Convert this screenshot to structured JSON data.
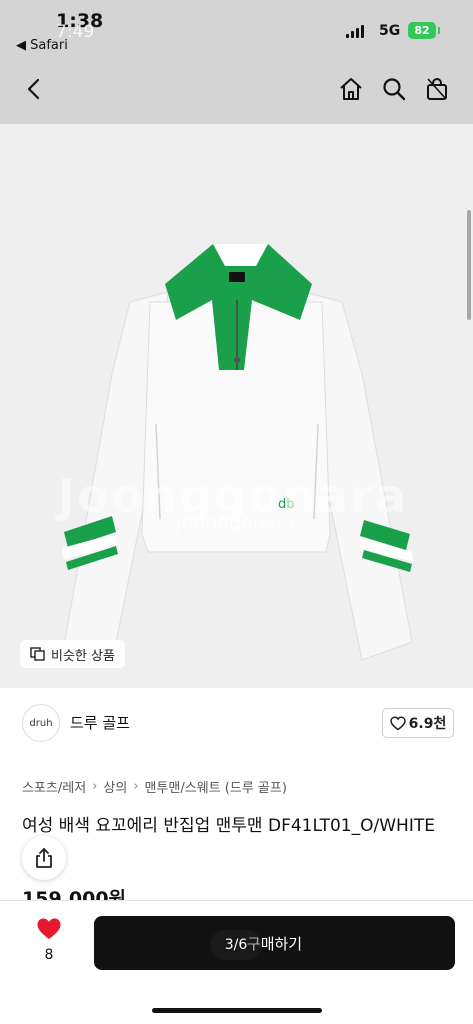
{
  "status": {
    "time": "1:38",
    "time_ghost": "7:49",
    "back_app": "◀ Safari",
    "network": "5G",
    "battery": "82"
  },
  "product": {
    "similar_label": "비슷한 상품",
    "watermark": "Joonggonara",
    "seller_logo": "druh",
    "seller_name": "드루 골프",
    "likes": "6.9천",
    "breadcrumb": [
      "스포츠/레저",
      "상의",
      "맨투맨/스웨트 (드루 골프)"
    ],
    "title": "여성 배색 요꼬에리 반집업 맨투맨 DF41LT01_O/WHITE",
    "price": "159,000원",
    "image_index": "3/6"
  },
  "bottom": {
    "wish_count": "8",
    "buy_label": "구매하기"
  },
  "colors": {
    "accent_green": "#1aa04a",
    "heart_red": "#e8192c",
    "battery_green": "#34c759"
  }
}
